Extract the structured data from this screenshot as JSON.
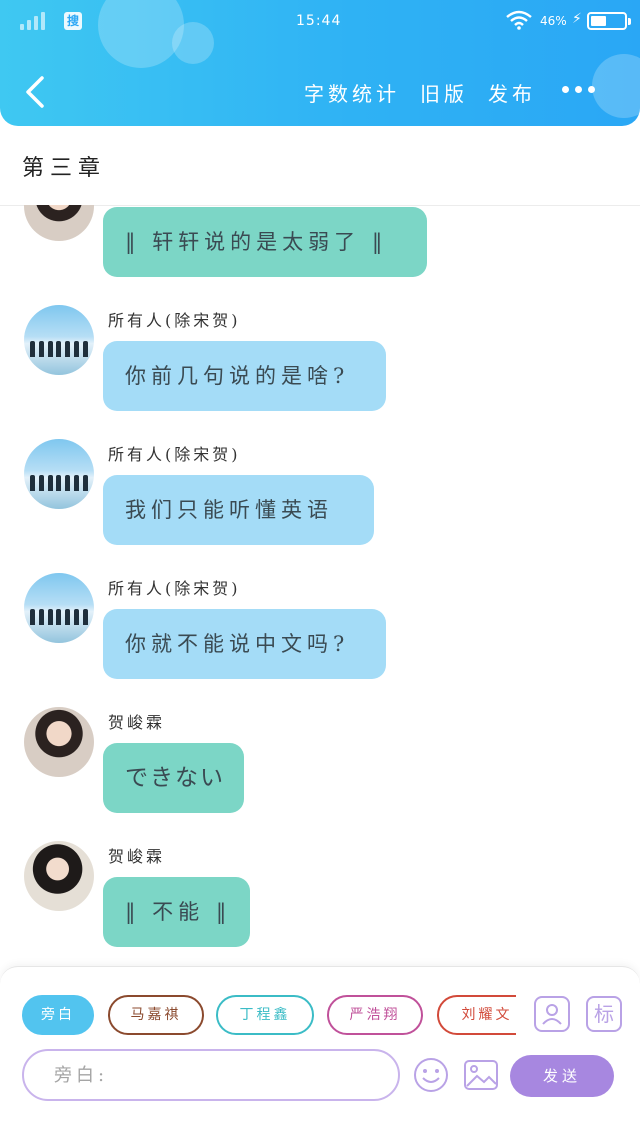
{
  "status_bar": {
    "search_badge": "搜",
    "time": "15:44",
    "battery_percent": "46%",
    "battery_level": 0.46,
    "wifi_icon": "wifi-icon"
  },
  "header": {
    "back_icon": "chevron-left-icon",
    "actions": [
      "字数统计",
      "旧版",
      "发布"
    ],
    "more_icon": "more-dots-icon",
    "colors": {
      "gradient_start": "#3fc8f2",
      "gradient_end": "#2aa7f5"
    }
  },
  "chapter": {
    "title": "第三章"
  },
  "messages": [
    {
      "sender": "",
      "text": "‖ 轩轩说的是太弱了 ‖",
      "color": "green",
      "avatar": "person"
    },
    {
      "sender": "所有人(除宋贺)",
      "text": "你前几句说的是啥?",
      "color": "blue",
      "avatar": "group"
    },
    {
      "sender": "所有人(除宋贺)",
      "text": "我们只能听懂英语",
      "color": "blue",
      "avatar": "group"
    },
    {
      "sender": "所有人(除宋贺)",
      "text": "你就不能说中文吗?",
      "color": "blue",
      "avatar": "group"
    },
    {
      "sender": "贺峻霖",
      "text": "できない",
      "color": "green",
      "avatar": "person"
    },
    {
      "sender": "贺峻霖",
      "text": "‖ 不能 ‖",
      "color": "green",
      "avatar": "person-alt"
    }
  ],
  "composer": {
    "role_chips": [
      {
        "label": "旁白",
        "active": true,
        "color": "#52c4ef"
      },
      {
        "label": "马嘉祺",
        "active": false,
        "color": "#8b4a2e"
      },
      {
        "label": "丁程鑫",
        "active": false,
        "color": "#3bbcc6"
      },
      {
        "label": "严浩翔",
        "active": false,
        "color": "#c0519a"
      },
      {
        "label": "刘耀文",
        "active": false,
        "color": "#d24a3a"
      }
    ],
    "role_icon": "person-card-icon",
    "tag_label": "标",
    "input_placeholder": "旁白:",
    "emoji_icon": "emoji-icon",
    "image_icon": "image-icon",
    "send_label": "发送",
    "colors": {
      "accent": "#a787e0",
      "border": "#c9b4ec"
    }
  }
}
